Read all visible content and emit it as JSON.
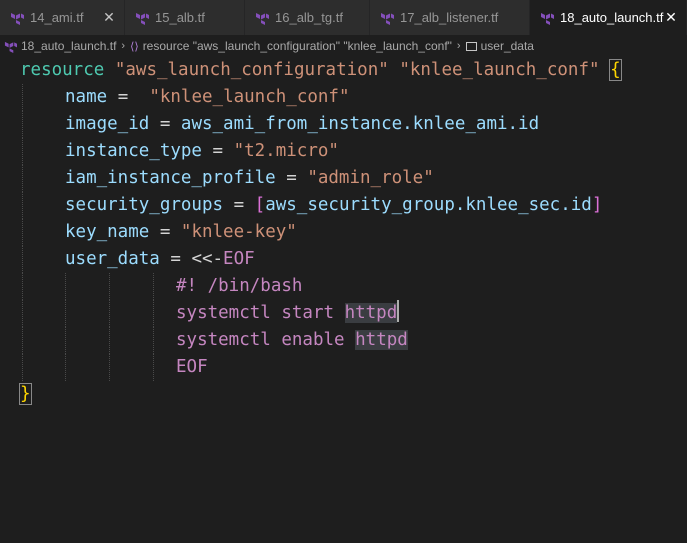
{
  "tabs": [
    {
      "label": "14_ami.tf",
      "active": false,
      "closable": true
    },
    {
      "label": "15_alb.tf",
      "active": false,
      "closable": false
    },
    {
      "label": "16_alb_tg.tf",
      "active": false,
      "closable": false
    },
    {
      "label": "17_alb_listener.tf",
      "active": false,
      "closable": false
    },
    {
      "label": "18_auto_launch.tf",
      "active": true,
      "closable": true
    }
  ],
  "breadcrumb": {
    "file": "18_auto_launch.tf",
    "resource": "resource \"aws_launch_configuration\" \"knlee_launch_conf\"",
    "property": "user_data"
  },
  "code": {
    "l1": {
      "kw": "resource",
      "s1": "\"aws_launch_configuration\"",
      "s2": "\"knlee_launch_conf\"",
      "brace": "{"
    },
    "l2": {
      "attr": "name",
      "eq": " = ",
      "str": "\"knlee_launch_conf\""
    },
    "l3": {
      "attr": "image_id",
      "eq": " = ",
      "value": "aws_ami_from_instance.knlee_ami.id"
    },
    "l4": {
      "attr": "instance_type",
      "eq": " = ",
      "str": "\"t2.micro\""
    },
    "l5": {
      "attr": "iam_instance_profile",
      "eq": " = ",
      "str": "\"admin_role\""
    },
    "l6": {
      "attr": "security_groups",
      "eq": " = ",
      "open": "[",
      "value": "aws_security_group.knlee_sec.id",
      "close": "]"
    },
    "l7": {
      "attr": "key_name",
      "eq": " = ",
      "str": "\"knlee-key\""
    },
    "l8": {
      "attr": "user_data",
      "eq": " = ",
      "heredoc_op": "<<-",
      "heredoc_tag": "EOF"
    },
    "l9": {
      "text": "#! /bin/bash"
    },
    "l10": {
      "pre": "systemctl start ",
      "word": "httpd"
    },
    "l11": {
      "pre": "systemctl enable ",
      "word": "httpd"
    },
    "l12": {
      "tag": "EOF"
    },
    "l13": {
      "brace": "}"
    }
  },
  "colors": {
    "background": "#1e1e1e",
    "keyword": "#4ec9b0",
    "string": "#ce9178",
    "attribute": "#9cdcfe",
    "heredoc": "#c586c0",
    "brace": "#ffd700",
    "terraform_icon": "#844fba"
  }
}
